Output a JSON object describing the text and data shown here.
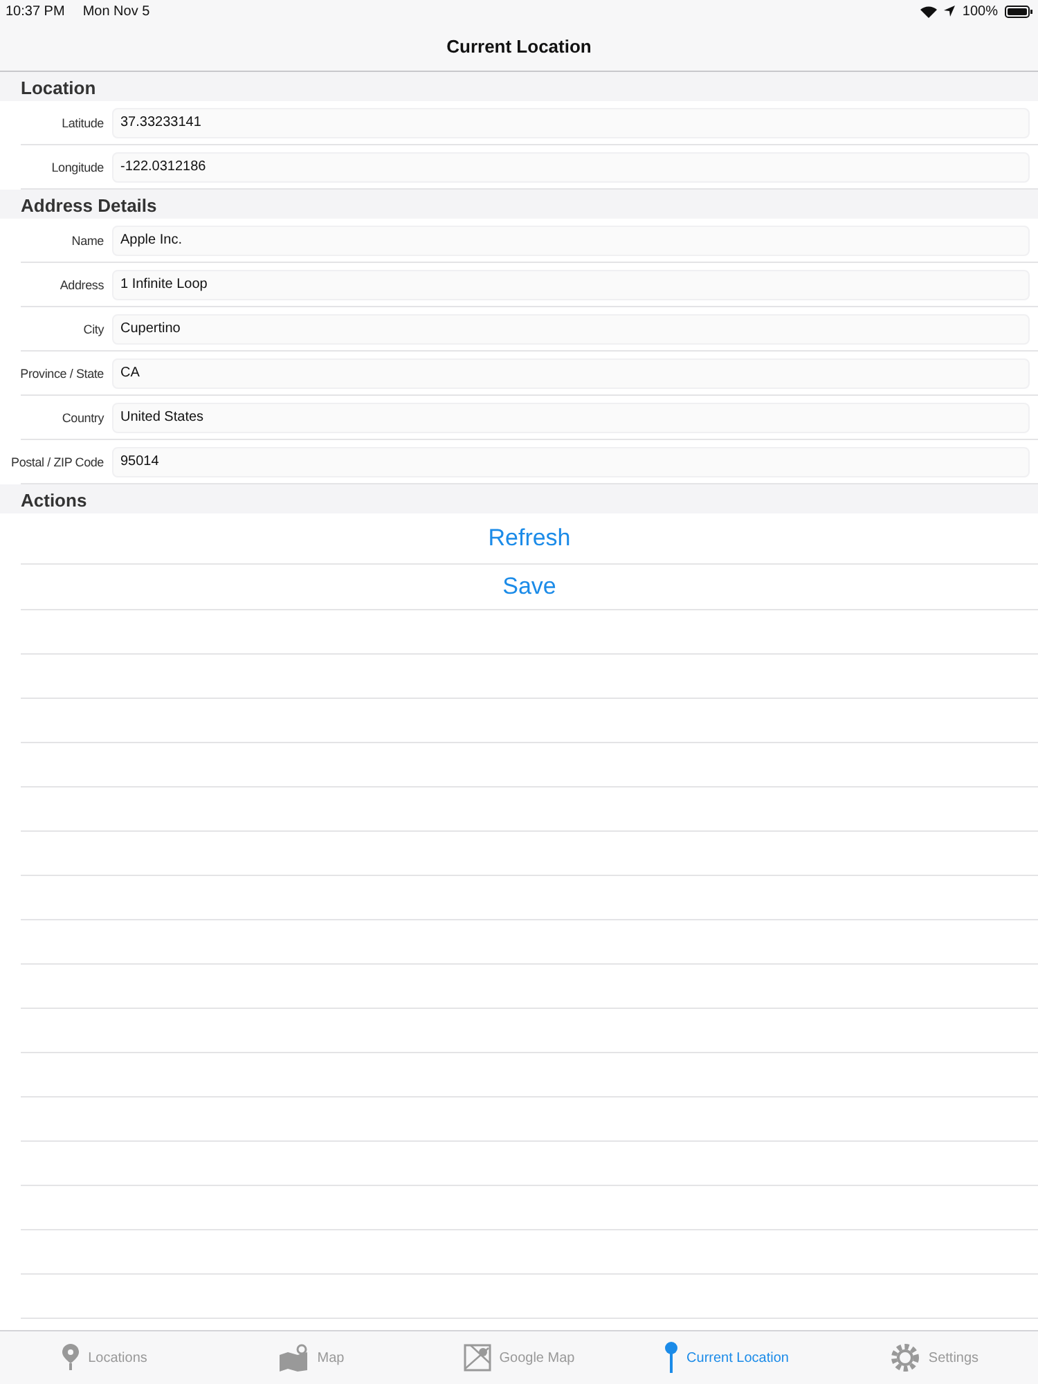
{
  "status_bar": {
    "time": "10:37 PM",
    "date": "Mon Nov 5",
    "battery": "100%"
  },
  "nav_bar": {
    "title": "Current Location"
  },
  "sections": [
    {
      "title": "Location",
      "fields": [
        {
          "label": "Latitude",
          "value": "37.33233141"
        },
        {
          "label": "Longitude",
          "value": "-122.0312186"
        }
      ]
    },
    {
      "title": "Address Details",
      "fields": [
        {
          "label": "Name",
          "value": "Apple Inc."
        },
        {
          "label": "Address",
          "value": "1 Infinite Loop"
        },
        {
          "label": "City",
          "value": "Cupertino"
        },
        {
          "label": "Province / State",
          "value": "CA"
        },
        {
          "label": "Country",
          "value": "United States"
        },
        {
          "label": "Postal / ZIP Code",
          "value": "95014"
        }
      ]
    },
    {
      "title": "Actions",
      "actions": [
        "Refresh",
        "Save"
      ]
    }
  ],
  "tab_bar": [
    {
      "label": "Locations",
      "selected": false
    },
    {
      "label": "Map",
      "selected": false
    },
    {
      "label": "Google Map",
      "selected": false
    },
    {
      "label": "Current Location",
      "selected": true
    },
    {
      "label": "Settings",
      "selected": false
    }
  ]
}
